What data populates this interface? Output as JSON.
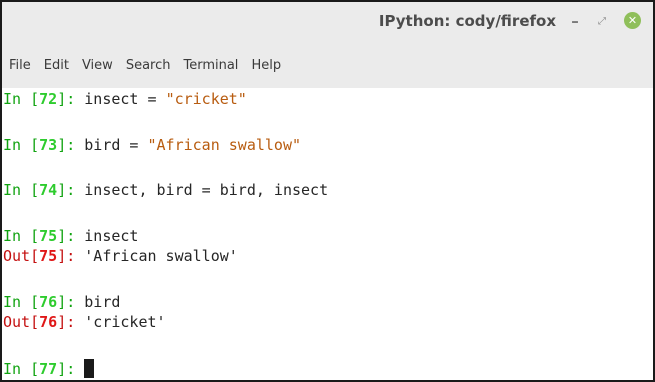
{
  "window": {
    "title": "IPython: cody/firefox",
    "minimize_glyph": "–",
    "maximize_glyph": "⤢",
    "close_glyph": "✕"
  },
  "menubar": {
    "items": [
      "File",
      "Edit",
      "View",
      "Search",
      "Terminal",
      "Help"
    ]
  },
  "terminal": {
    "in_label": "In [",
    "out_label": "Out[",
    "close_bracket": "]: ",
    "cells": [
      {
        "number": "72",
        "input": "insect = ",
        "input_string": "\"cricket\""
      },
      {
        "number": "73",
        "input": "bird = ",
        "input_string": "\"African swallow\""
      },
      {
        "number": "74",
        "input": "insect, bird = bird, insect"
      },
      {
        "number": "75",
        "input": "insect",
        "output": "'African swallow'"
      },
      {
        "number": "76",
        "input": "bird",
        "output": "'cricket'"
      },
      {
        "number": "77",
        "input": ""
      }
    ]
  },
  "colors": {
    "prompt_in": "#11a311",
    "prompt_in_number": "#2ecc2e",
    "prompt_out": "#c41010",
    "prompt_out_number": "#e01818",
    "string": "#b85c10",
    "close_button": "#8fbf5a"
  }
}
